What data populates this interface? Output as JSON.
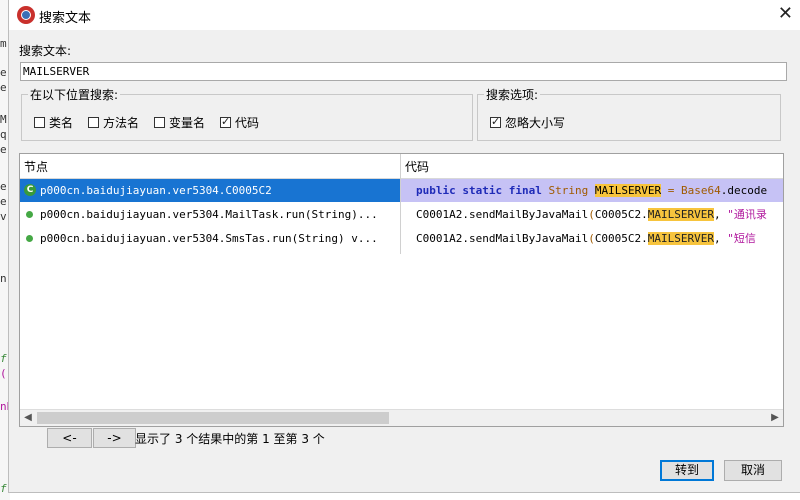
{
  "dialog": {
    "title": "搜索文本",
    "close_symbol": "✕"
  },
  "search": {
    "label": "搜索文本:",
    "value": "MAILSERVER"
  },
  "location_group": {
    "legend": "在以下位置搜索:",
    "options": [
      {
        "label": "类名",
        "checked": false
      },
      {
        "label": "方法名",
        "checked": false
      },
      {
        "label": "变量名",
        "checked": false
      },
      {
        "label": "代码",
        "checked": true
      }
    ]
  },
  "options_group": {
    "legend": "搜索选项:",
    "options": [
      {
        "label": "忽略大小写",
        "checked": true
      }
    ]
  },
  "results": {
    "columns": [
      "节点",
      "代码"
    ],
    "rows": [
      {
        "icon": "class-icon",
        "node": "p000cn.baidujiayuan.ver5304.C0005C2",
        "code": {
          "kw": "public static final",
          "type": "String",
          "match": "MAILSERVER",
          "assign": "=",
          "expr": "Base64",
          "rest": ".decode"
        },
        "selected": true
      },
      {
        "icon": "method-icon",
        "node": "p000cn.baidujiayuan.ver5304.MailTask.run(String)...",
        "code": {
          "pre": "C0001A2.sendMailByJavaMail",
          "paren": "(",
          "cls": "C0005C2.",
          "match": "MAILSERVER",
          "comma": ", ",
          "str": "\"通讯录"
        },
        "selected": false
      },
      {
        "icon": "method-icon",
        "node": "p000cn.baidujiayuan.ver5304.SmsTas.run(String) v...",
        "code": {
          "pre": "C0001A2.sendMailByJavaMail",
          "paren": "(",
          "cls": "C0005C2.",
          "match": "MAILSERVER",
          "comma": ", ",
          "str": "\"短信"
        },
        "selected": false
      }
    ]
  },
  "pager": {
    "prev_label": "<-",
    "next_label": "->",
    "status": "显示了 3 个结果中的第 1 至第 3 个"
  },
  "buttons": {
    "goto_label": "转到",
    "cancel_label": "取消"
  },
  "background_editor": {
    "fragments": [
      "m",
      "e",
      "e",
      "M",
      "q",
      "e",
      "e",
      "e",
      "v",
      "n",
      "f",
      "(",
      "nB",
      "f"
    ]
  },
  "colors": {
    "selection_bg": "#1874d2",
    "code_selection_bg": "#c6c2f5",
    "match_highlight": "#f7c43d",
    "keyword": "#1f2bb8",
    "string": "#b0179d"
  }
}
